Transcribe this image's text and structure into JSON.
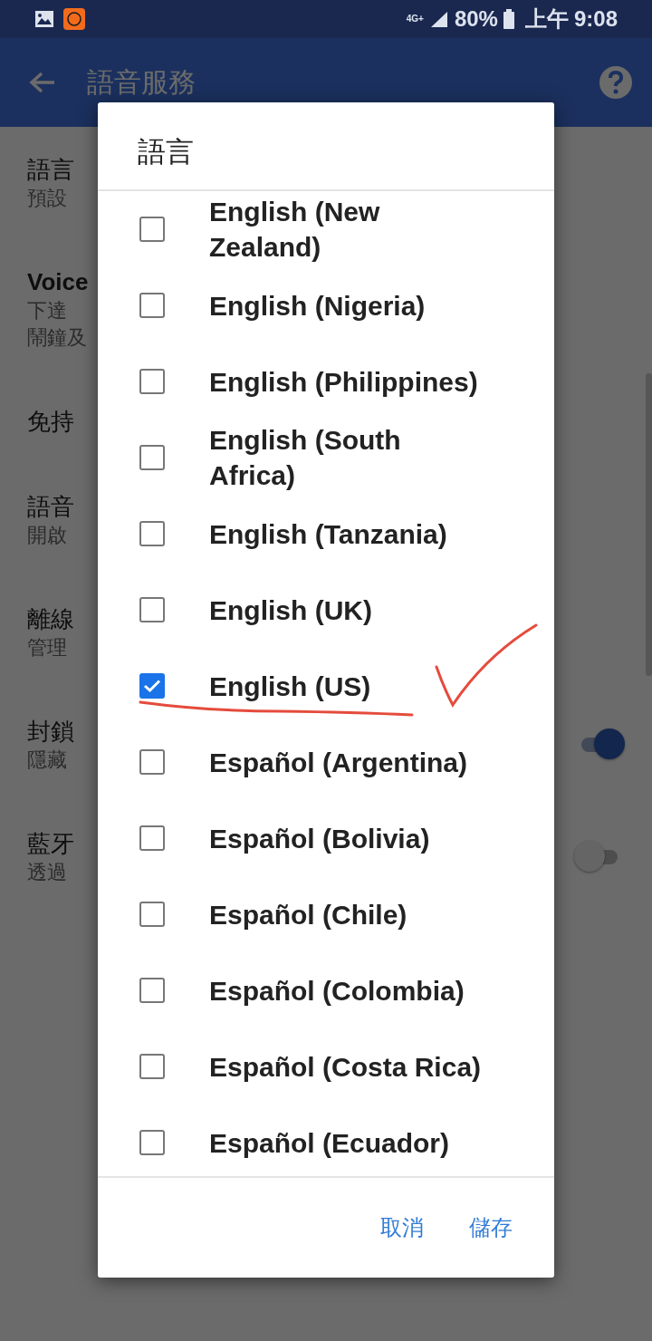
{
  "status_bar": {
    "network": "4G+",
    "battery": "80%",
    "time_period": "上午",
    "time": "9:08"
  },
  "toolbar": {
    "title": "語音服務"
  },
  "settings": [
    {
      "title": "語言",
      "subtitle": [
        "預設"
      ]
    },
    {
      "title": "Voice",
      "subtitle": [
        "下達",
        "鬧鐘及"
      ]
    },
    {
      "title": "免持"
    },
    {
      "title": "語音",
      "subtitle": [
        "開啟"
      ]
    },
    {
      "title": "離線",
      "subtitle": [
        "管理"
      ]
    },
    {
      "title": "封鎖",
      "subtitle": [
        "隱藏"
      ],
      "on": true
    },
    {
      "title": "藍牙",
      "subtitle": [
        "透過"
      ],
      "on": false
    }
  ],
  "dialog": {
    "title": "語言",
    "options": [
      {
        "label": "English (New Zealand)",
        "checked": false
      },
      {
        "label": "English (Nigeria)",
        "checked": false
      },
      {
        "label": "English (Philippines)",
        "checked": false
      },
      {
        "label": "English (South Africa)",
        "checked": false
      },
      {
        "label": "English (Tanzania)",
        "checked": false
      },
      {
        "label": "English (UK)",
        "checked": false
      },
      {
        "label": "English (US)",
        "checked": true
      },
      {
        "label": "Español (Argentina)",
        "checked": false
      },
      {
        "label": "Español (Bolivia)",
        "checked": false
      },
      {
        "label": "Español (Chile)",
        "checked": false
      },
      {
        "label": "Español (Colombia)",
        "checked": false
      },
      {
        "label": "Español (Costa Rica)",
        "checked": false
      },
      {
        "label": "Español (Ecuador)",
        "checked": false
      }
    ],
    "buttons": [
      "取消",
      "儲存"
    ]
  }
}
